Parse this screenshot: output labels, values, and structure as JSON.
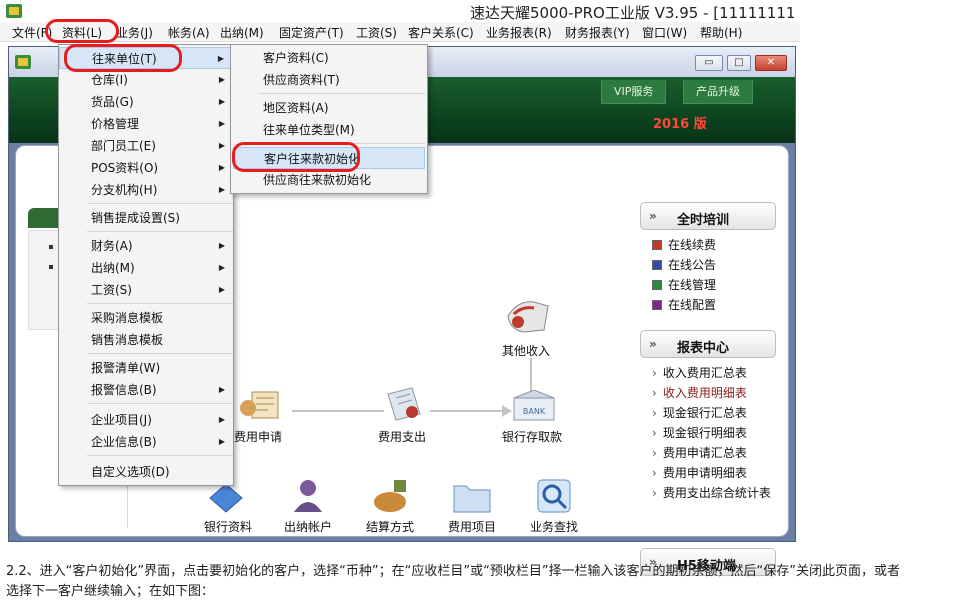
{
  "app": {
    "title": "速达天耀5000-PRO工业版 V3.95 - [11111111"
  },
  "menubar": {
    "items": [
      "文件(F)",
      "资料(L)",
      "业务(J)",
      "帐务(A)",
      "出纳(M)",
      "固定资产(T)",
      "工资(S)",
      "客户关系(C)",
      "业务报表(R)",
      "财务报表(Y)",
      "窗口(W)",
      "帮助(H)"
    ]
  },
  "child_window": {
    "min_label": "▭",
    "max_label": "□",
    "close_label": "✕"
  },
  "banner": {
    "vip": "VIP服务",
    "upgrade": "产品升级",
    "year": "2016 版"
  },
  "menu_ziliao": {
    "items": [
      {
        "label": "往来单位(T)",
        "submenu": true
      },
      {
        "label": "仓库(I)",
        "submenu": true
      },
      {
        "label": "货品(G)",
        "submenu": true
      },
      {
        "label": "价格管理",
        "submenu": true
      },
      {
        "label": "部门员工(E)",
        "submenu": true
      },
      {
        "label": "POS资料(O)",
        "submenu": true
      },
      {
        "label": "分支机构(H)",
        "submenu": true
      },
      {
        "label": "销售提成设置(S)",
        "submenu": false
      },
      {
        "label": "财务(A)",
        "submenu": true
      },
      {
        "label": "出纳(M)",
        "submenu": true
      },
      {
        "label": "工资(S)",
        "submenu": true
      },
      {
        "label": "采购消息模板",
        "submenu": false
      },
      {
        "label": "销售消息模板",
        "submenu": false
      },
      {
        "label": "报警清单(W)",
        "submenu": false
      },
      {
        "label": "报警信息(B)",
        "submenu": true
      },
      {
        "label": "企业项目(J)",
        "submenu": true
      },
      {
        "label": "企业信息(B)",
        "submenu": true
      },
      {
        "label": "自定义选项(D)",
        "submenu": false
      }
    ]
  },
  "menu_wanglai": {
    "items": [
      {
        "label": "客户资料(C)"
      },
      {
        "label": "供应商资料(T)"
      },
      {
        "label": "地区资料(A)"
      },
      {
        "label": "往来单位类型(M)"
      },
      {
        "label": "客户往来款初始化"
      },
      {
        "label": "供应商往来款初始化"
      }
    ]
  },
  "flow": {
    "other_income": "其他收入",
    "expense_apply": "费用申请",
    "expense_pay": "费用支出",
    "bank_deposit": "银行存取款",
    "bank_icon_text": "BANK"
  },
  "side": {
    "training_title": "全时培训",
    "training_links": [
      "在线续费",
      "在线公告",
      "在线管理",
      "在线配置"
    ],
    "training_colors": [
      "#c0392b",
      "#2e4fa3",
      "#2d8a3e",
      "#7a2a8a"
    ],
    "report_title": "报表中心",
    "report_links": [
      "收入费用汇总表",
      "收入费用明细表",
      "现金银行汇总表",
      "现金银行明细表",
      "费用申请汇总表",
      "费用申请明细表",
      "费用支出综合统计表"
    ],
    "h5_title": "H5移动端",
    "chev": "»",
    "link_chev": "›"
  },
  "bottom": {
    "items": [
      "银行资料",
      "出纳帐户",
      "结算方式",
      "费用项目",
      "业务查找"
    ]
  },
  "caption": {
    "line1": "2.2、进入“客户初始化”界面，点击要初始化的客户，选择“币种”；在“应收栏目”或“预收栏目”择一栏输入该客户的期初余额，然后“保存”关闭此页面，或者",
    "line2": "选择下一客户继续输入；在如下图："
  },
  "colors": {
    "annotation": "#e81c1c",
    "banner": "#0b3f1c",
    "year": "#ff4a3a",
    "highlight_link": "#8b1c1c"
  }
}
